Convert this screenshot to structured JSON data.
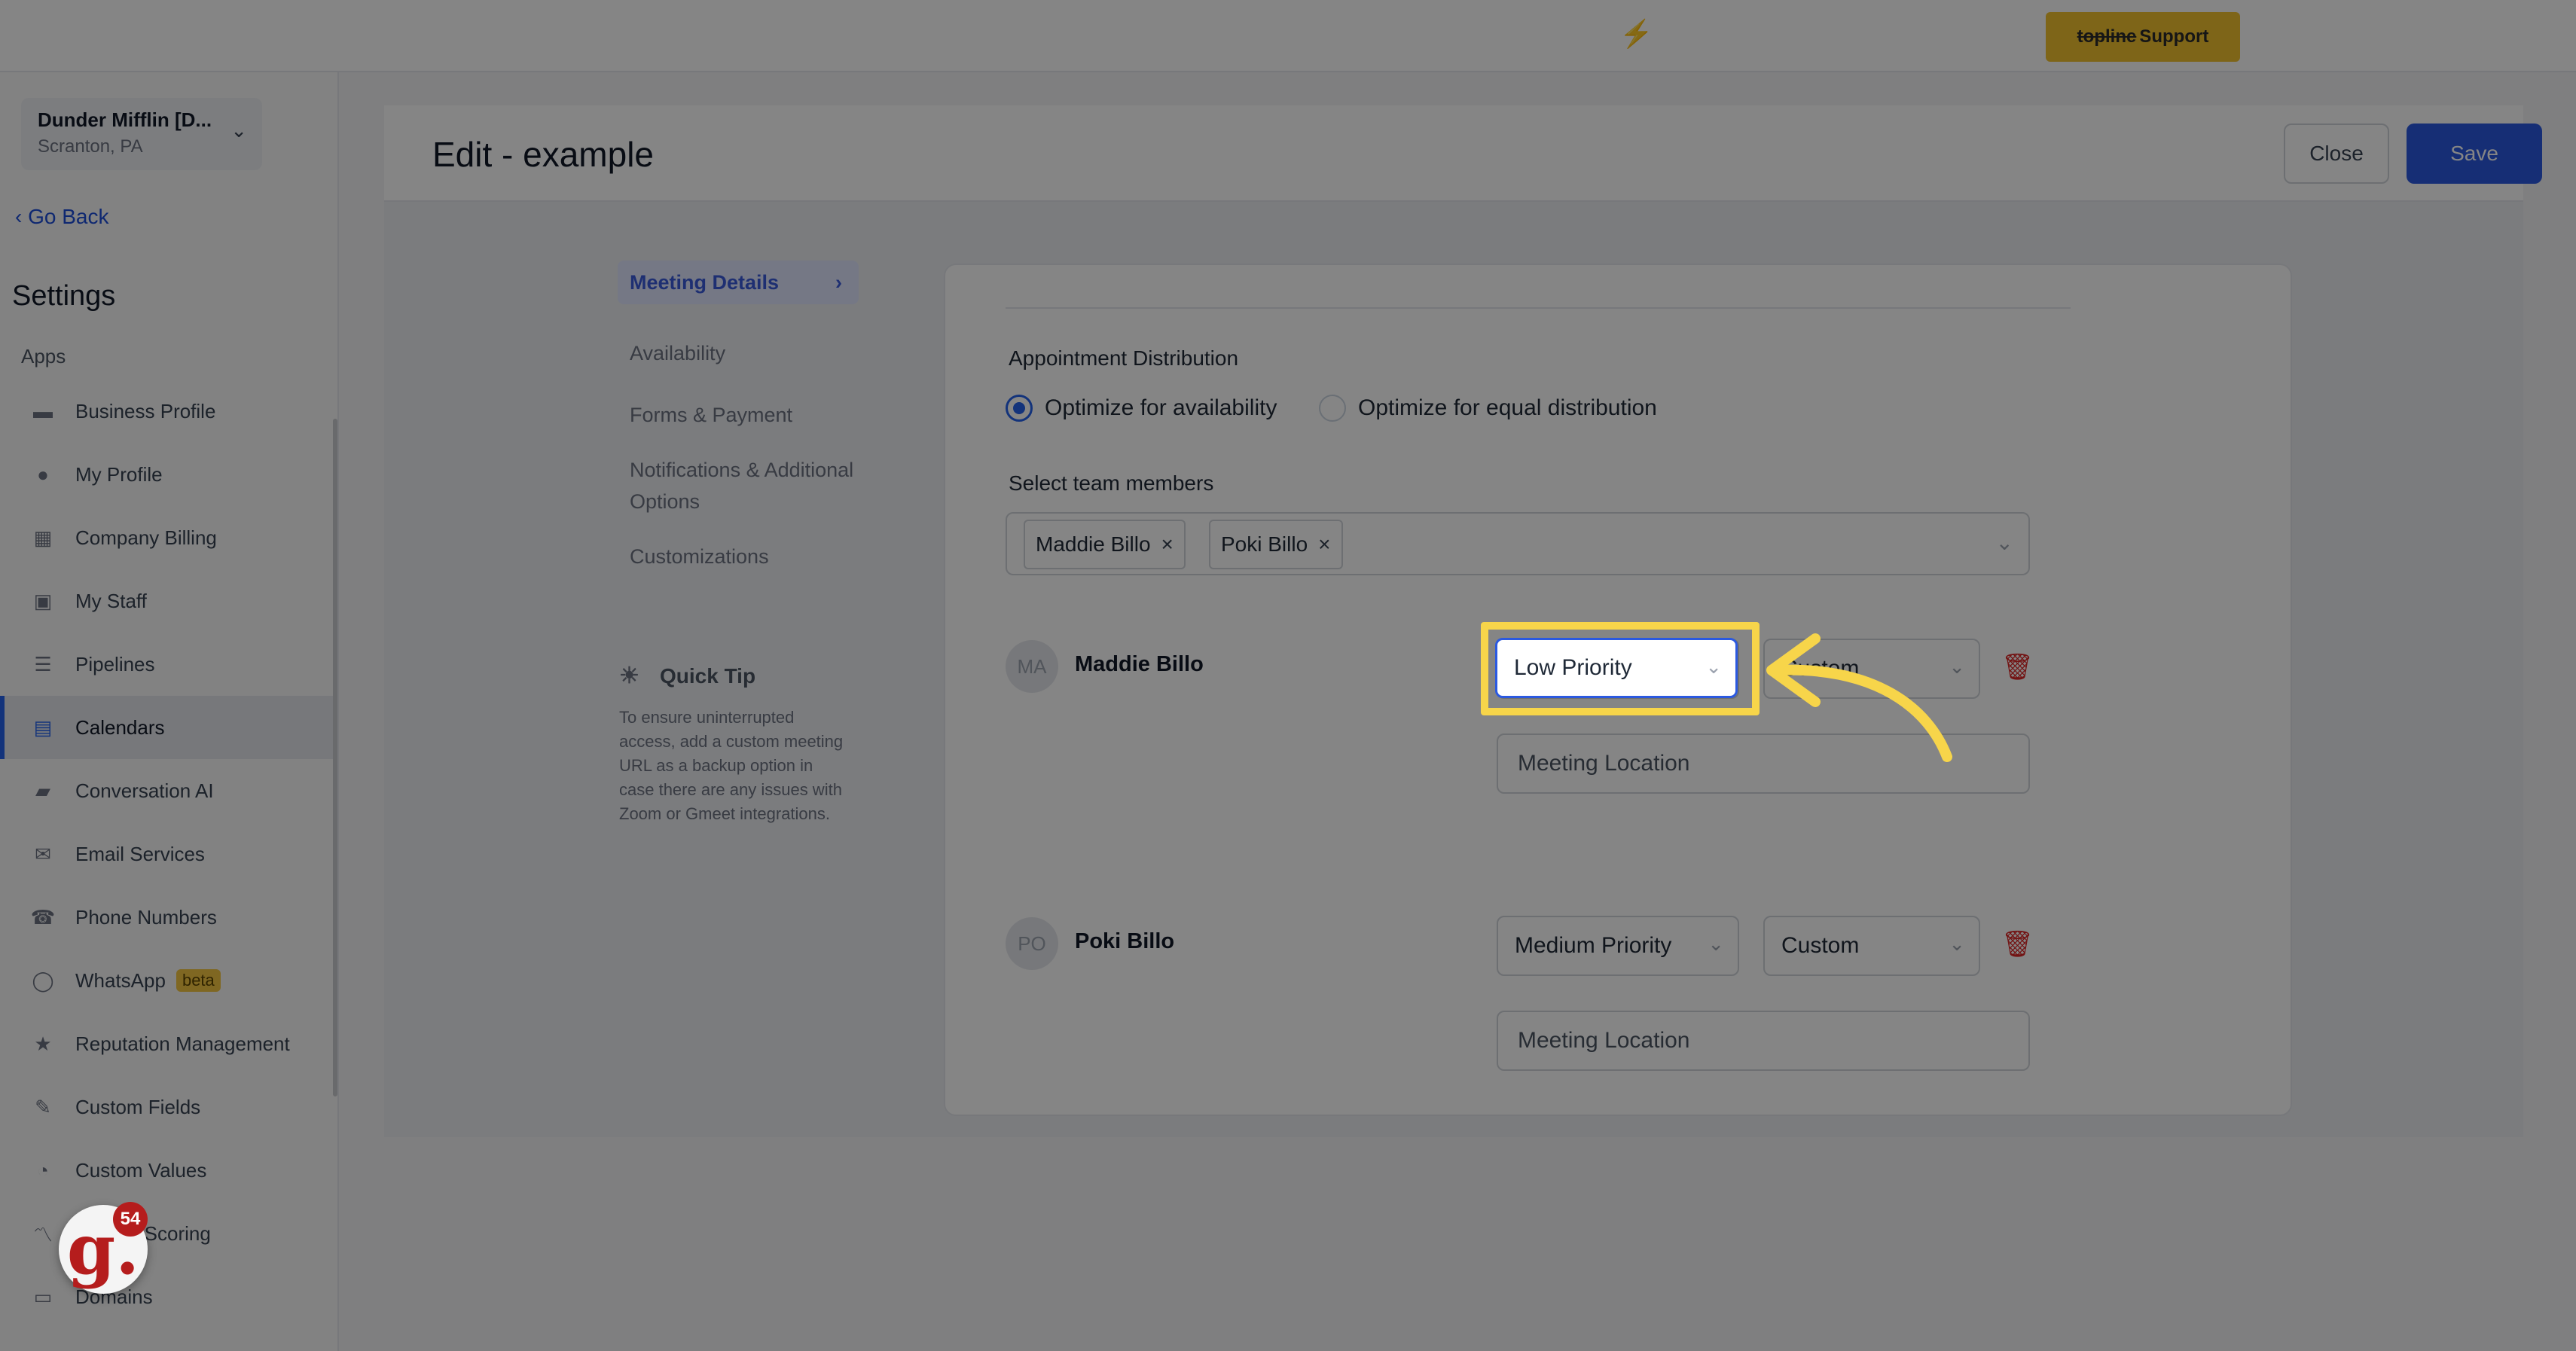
{
  "topbar": {
    "support_strike": "topline",
    "support_label": "Support",
    "bolt": "⚡"
  },
  "sidebar": {
    "location_name": "Dunder Mifflin [D...",
    "location_sub": "Scranton, PA",
    "go_back": "Go Back",
    "settings_title": "Settings",
    "apps_label": "Apps",
    "items": [
      {
        "label": "Business Profile",
        "icon": "briefcase-icon"
      },
      {
        "label": "My Profile",
        "icon": "person-icon"
      },
      {
        "label": "Company Billing",
        "icon": "grid-icon"
      },
      {
        "label": "My Staff",
        "icon": "inbox-icon"
      },
      {
        "label": "Pipelines",
        "icon": "filter-icon"
      },
      {
        "label": "Calendars",
        "icon": "calendar-icon"
      },
      {
        "label": "Conversation AI",
        "icon": "chat-icon"
      },
      {
        "label": "Email Services",
        "icon": "mail-icon"
      },
      {
        "label": "Phone Numbers",
        "icon": "phone-icon"
      },
      {
        "label": "WhatsApp",
        "icon": "whatsapp-icon"
      },
      {
        "label": "Reputation Management",
        "icon": "star-icon"
      },
      {
        "label": "Custom Fields",
        "icon": "edit-icon"
      },
      {
        "label": "Custom Values",
        "icon": "pie-icon"
      },
      {
        "label": "e Scoring",
        "icon": "chart-icon"
      },
      {
        "label": "Domains",
        "icon": "server-icon"
      }
    ],
    "beta_label": "beta"
  },
  "header": {
    "title": "Edit - example",
    "close_label": "Close",
    "save_label": "Save"
  },
  "subnav": {
    "items": [
      "Meeting Details",
      "Availability",
      "Forms & Payment",
      "Notifications & Additional Options",
      "Customizations"
    ]
  },
  "quick_tip": {
    "title": "Quick Tip",
    "text": "To ensure uninterrupted access, add a custom meeting URL as a backup option in case there are any issues with Zoom or Gmeet integrations."
  },
  "form": {
    "distribution_label": "Appointment Distribution",
    "radio_availability": "Optimize for availability",
    "radio_equal": "Optimize for equal distribution",
    "selected_radio": "availability",
    "team_label": "Select team members",
    "chips": [
      "Maddie Billo",
      "Poki Billo"
    ],
    "members": [
      {
        "initials": "MA",
        "name": "Maddie Billo",
        "priority": "Low Priority",
        "meeting_type": "Custom",
        "location_placeholder": "Meeting Location"
      },
      {
        "initials": "PO",
        "name": "Poki Billo",
        "priority": "Medium Priority",
        "meeting_type": "Custom",
        "location_placeholder": "Meeting Location"
      }
    ]
  },
  "badge": {
    "letter": "g.",
    "count": "54"
  },
  "colors": {
    "accent": "#2b59e0",
    "highlight": "#f7d54a",
    "danger": "#dc2626"
  }
}
